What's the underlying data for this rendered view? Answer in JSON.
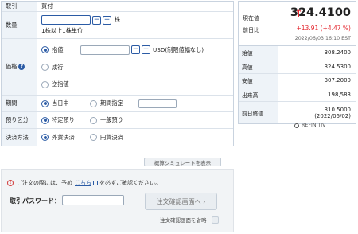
{
  "order": {
    "trade_label": "取引",
    "trade_value": "買付",
    "qty_label": "数量",
    "qty_value": "",
    "qty_unit": "株",
    "qty_note": "1株以上1株単位",
    "price_label": "価格",
    "price_limit": "指値",
    "price_limit_value": "",
    "price_currency_note": "USD(制限値幅なし)",
    "price_market": "成行",
    "price_stop": "逆指値",
    "period_label": "期間",
    "period_today": "当日中",
    "period_specified": "期間指定",
    "period_date_value": "",
    "custody_label": "預り区分",
    "custody_specific": "特定預り",
    "custody_general": "一般預り",
    "settle_label": "決済方法",
    "settle_fx": "外貨決済",
    "settle_jpy": "円貨決済",
    "sim_button": "概算シミュレートを表示",
    "plus": "+",
    "minus": "−"
  },
  "confirm": {
    "note_prefix": "ご注文の際には、予め",
    "note_link": "こちら",
    "note_suffix": "を必ずご確認ください。",
    "pw_label": "取引パスワード：",
    "pw_value": "",
    "go_button": "注文確認画面へ ›",
    "skip_label": "注文確認画面を省略",
    "warn_icon": "!"
  },
  "quote": {
    "current_label": "現在値",
    "prev_diff_label": "前日比",
    "price": "324.4100",
    "change": "+13.91 (+4.47 %)",
    "timestamp": "2022/06/03 16:10 EST",
    "rows": [
      {
        "label": "始値",
        "value": "308.2400",
        "sub": ""
      },
      {
        "label": "高値",
        "value": "324.5300",
        "sub": ""
      },
      {
        "label": "安値",
        "value": "307.2000",
        "sub": ""
      },
      {
        "label": "出来高",
        "value": "198,583",
        "sub": ""
      },
      {
        "label": "前日終値",
        "value": "310.5000",
        "sub": "(2022/06/02)"
      }
    ],
    "source": "REFINITIV",
    "up_color": "#e4252d"
  }
}
